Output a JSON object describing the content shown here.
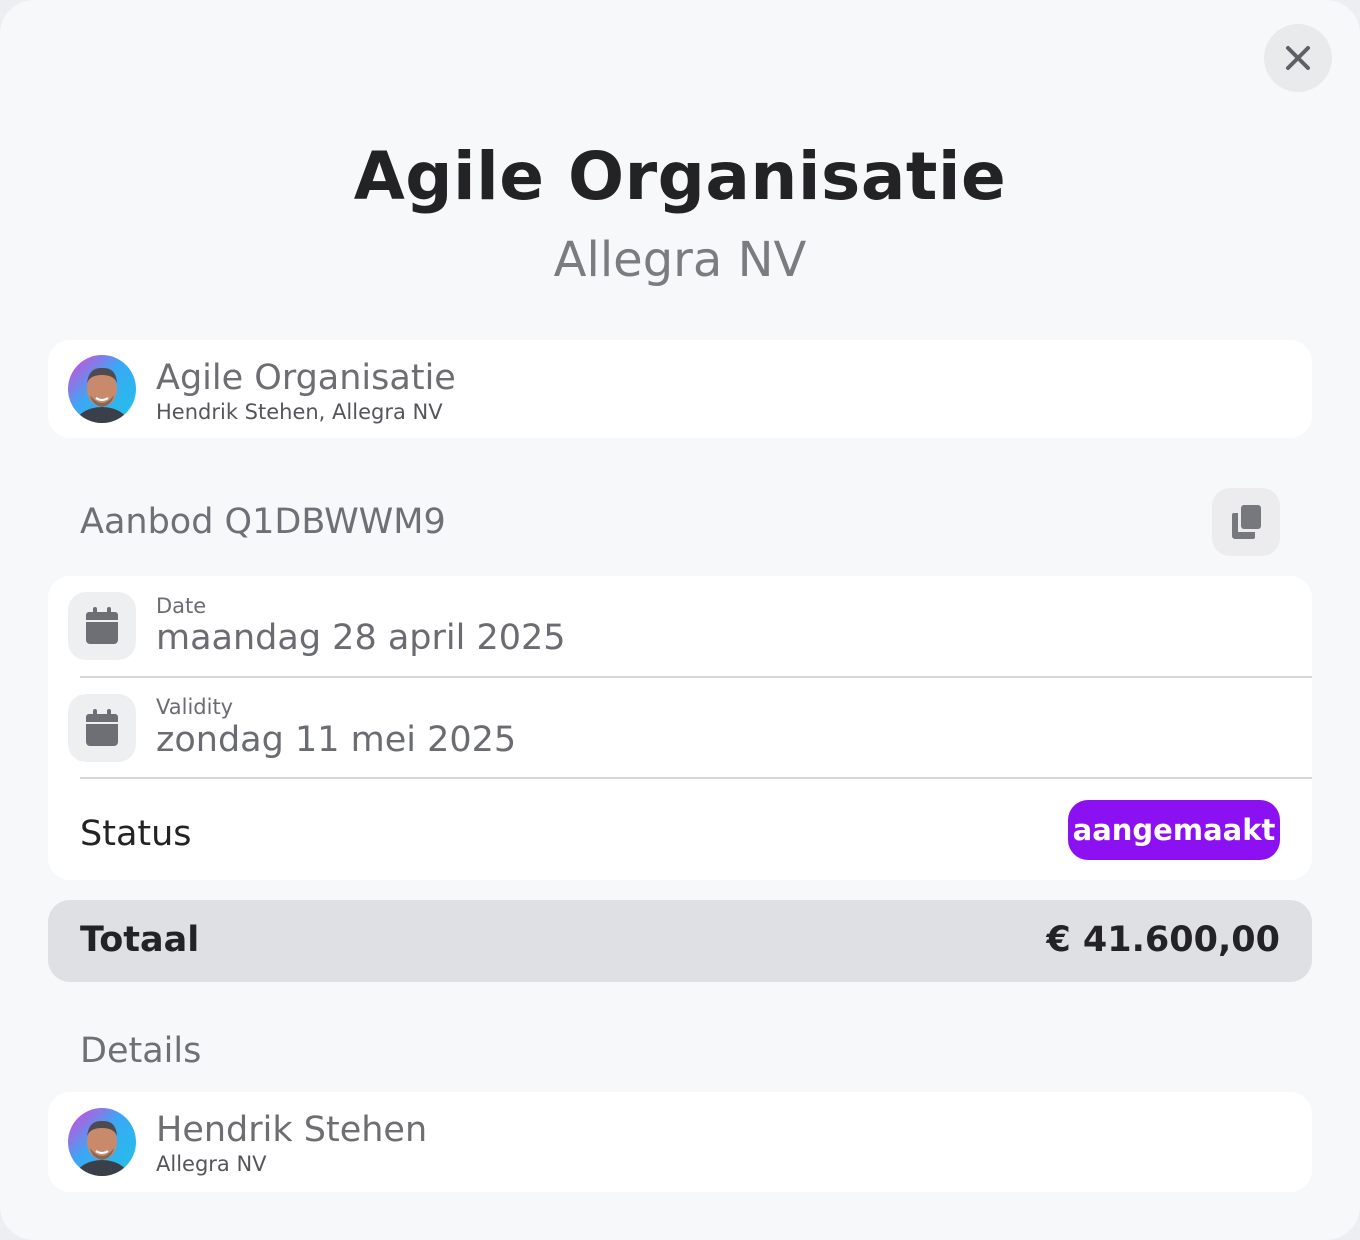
{
  "header": {
    "title": "Agile Organisatie",
    "subtitle": "Allegra NV"
  },
  "icons": {
    "close": "close-icon",
    "copy": "copy-icon",
    "calendar": "calendar-icon"
  },
  "contact_card": {
    "name": "Agile Organisatie",
    "subtitle": "Hendrik Stehen, Allegra NV"
  },
  "offer": {
    "title": "Aanbod Q1DBWWM9",
    "date_label": "Date",
    "date_value": "maandag 28 april 2025",
    "validity_label": "Validity",
    "validity_value": "zondag 11 mei 2025",
    "status_label": "Status",
    "status_value": "aangemaakt"
  },
  "total": {
    "label": "Totaal",
    "value": "€ 41.600,00"
  },
  "details": {
    "title": "Details",
    "name": "Hendrik Stehen",
    "subtitle": "Allegra NV"
  },
  "colors": {
    "status_badge": "#8b10f2",
    "background": "#f7f8fa",
    "card": "#ffffff",
    "total_bar": "#dfe0e3"
  }
}
